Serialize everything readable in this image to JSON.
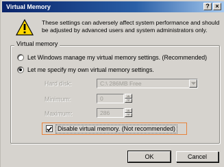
{
  "window": {
    "title": "Virtual Memory",
    "help_btn": "?",
    "close_btn": "×"
  },
  "warning": {
    "icon": "warning-triangle-icon",
    "text": "These settings can adversely affect system performance and should be adjusted by advanced users and system administrators only."
  },
  "virtual_memory": {
    "group_label": "Virtual memory",
    "option_windows": "Let Windows manage my virtual memory settings. (Recommended)",
    "option_manual": "Let me specify my own virtual memory settings.",
    "selected": "manual",
    "hard_disk_label": "Hard disk:",
    "hard_disk_value": "C:\\ 286MB Free",
    "minimum_label": "Minimum:",
    "minimum_value": "0",
    "maximum_label": "Maximum:",
    "maximum_value": "286",
    "disable_label": "Disable virtual memory. (Not recommended)",
    "disable_checked": true
  },
  "buttons": {
    "ok": "OK",
    "cancel": "Cancel"
  }
}
